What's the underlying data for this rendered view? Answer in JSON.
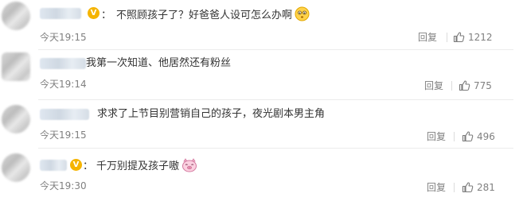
{
  "comments": [
    {
      "text_prefix": "：",
      "text": "不照顾孩子了？好爸爸人设可怎么办啊",
      "emoji": "shy-face-emoji",
      "time": "今天19:15",
      "reply_label": "回复",
      "likes": "1212",
      "verified": true
    },
    {
      "text_prefix": "",
      "text": "我第一次知道、他居然还有粉丝",
      "emoji": "",
      "time": "今天19:14",
      "reply_label": "回复",
      "likes": "775",
      "verified": false
    },
    {
      "text_prefix": "",
      "text": "求求了上节目别营销自己的孩子，夜光剧本男主角",
      "emoji": "",
      "time": "今天19:15",
      "reply_label": "回复",
      "likes": "496",
      "verified": false
    },
    {
      "text_prefix": "：",
      "text": "千万别提及孩子嗷",
      "emoji": "pig-face-emoji",
      "time": "今天19:30",
      "reply_label": "回复",
      "likes": "281",
      "verified": true
    }
  ],
  "colors": {
    "verified_badge": "#f5b400",
    "meta_text": "#808080",
    "body_text": "#333333"
  }
}
